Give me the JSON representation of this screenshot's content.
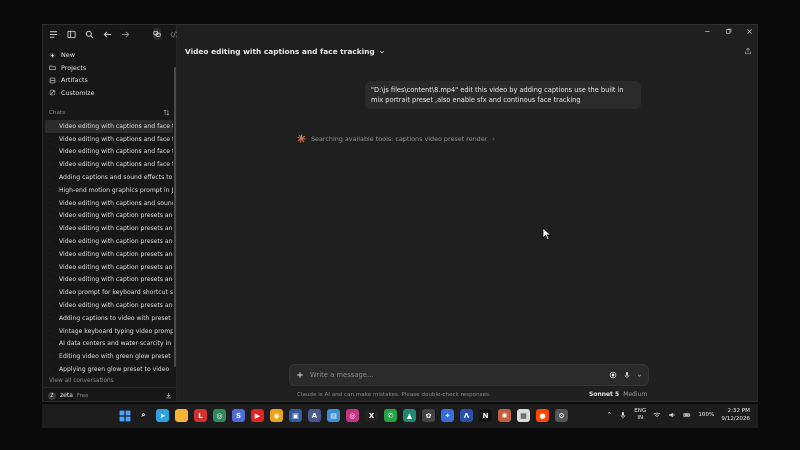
{
  "sidebar": {
    "nav": [
      {
        "label": "New",
        "icon": "plus-circle-icon"
      },
      {
        "label": "Projects",
        "icon": "folder-icon"
      },
      {
        "label": "Artifacts",
        "icon": "artifacts-icon"
      },
      {
        "label": "Customize",
        "icon": "customize-icon"
      }
    ],
    "chats_header": "Chats",
    "chats": [
      "Video editing with captions and face tr",
      "Video editing with captions and face tr",
      "Video editing with captions and face tr",
      "Video editing with captions and face tr",
      "Adding captions and sound effects to v",
      "High-end motion graphics prompt in JS",
      "Video editing with captions and sound",
      "Video editing with caption presets and",
      "Video editing with caption presets and",
      "Video editing with caption presets and",
      "Video editing with caption presets and",
      "Video editing with caption presets and",
      "Video editing with caption presets and",
      "Video prompt for keyboard shortcut sh",
      "Video editing with caption presets and",
      "Adding captions to video with preset",
      "Vintage keyboard typing video prompt",
      "AI data centers and water scarcity in In",
      "Editing video with green glow preset",
      "Applying green glow preset to video"
    ],
    "view_all": "View all conversations",
    "user": {
      "initial": "Z",
      "name": "zeta",
      "plan": "Free"
    }
  },
  "main": {
    "title": "Video editing with captions and face tracking",
    "user_message": "\"D:\\js files\\content\\8.mp4\" edit this video by adding captions use the built in mix portrait preset ,also enable sfx and continous face tracking",
    "status": "Searching available tools: captions video preset render",
    "composer_placeholder": "Write a message...",
    "model_name": "Sonnet 5",
    "model_mode": "Medium",
    "disclaimer": "Claude is AI and can make mistakes. Please double-check responses."
  },
  "taskbar": {
    "apps": [
      {
        "name": "windows-start-icon",
        "color": "#3b82f6",
        "glyph": ""
      },
      {
        "name": "search-icon",
        "color": "#1c1c1c",
        "glyph": "⌕"
      },
      {
        "name": "telegram-icon",
        "color": "#2aa3df",
        "glyph": "➤"
      },
      {
        "name": "file-explorer-icon",
        "color": "#f2b632",
        "glyph": ""
      },
      {
        "name": "app-l-icon",
        "color": "#d0312d",
        "glyph": "L"
      },
      {
        "name": "app-circle-icon",
        "color": "#2d8a5f",
        "glyph": "◎"
      },
      {
        "name": "app-s-icon",
        "color": "#4f6bd8",
        "glyph": "S"
      },
      {
        "name": "youtube-icon",
        "color": "#e02424",
        "glyph": "▶"
      },
      {
        "name": "chrome-icon",
        "color": "#e8a317",
        "glyph": "◉"
      },
      {
        "name": "app-photo-icon",
        "color": "#355c9c",
        "glyph": "▣"
      },
      {
        "name": "app-a-icon",
        "color": "#4a5a8c",
        "glyph": "A"
      },
      {
        "name": "app-book-icon",
        "color": "#3d8fd6",
        "glyph": "▤"
      },
      {
        "name": "instagram-icon",
        "color": "#c13584",
        "glyph": "◎"
      },
      {
        "name": "x-icon",
        "color": "#222222",
        "glyph": "X"
      },
      {
        "name": "whatsapp-icon",
        "color": "#25a244",
        "glyph": "✆"
      },
      {
        "name": "app-green-icon",
        "color": "#1f8a70",
        "glyph": "▲"
      },
      {
        "name": "chatgpt-icon",
        "color": "#444444",
        "glyph": "✿"
      },
      {
        "name": "gemini-icon",
        "color": "#3a6fd8",
        "glyph": "✦"
      },
      {
        "name": "app-blue-icon",
        "color": "#2b4fa8",
        "glyph": "Λ"
      },
      {
        "name": "notion-icon",
        "color": "#111111",
        "glyph": "N"
      },
      {
        "name": "claude-icon",
        "color": "#c2613c",
        "glyph": "✺"
      },
      {
        "name": "calendar-icon",
        "color": "#dcdcdc",
        "glyph": "▦"
      },
      {
        "name": "reddit-icon",
        "color": "#ff4500",
        "glyph": "●"
      },
      {
        "name": "settings-icon",
        "color": "#555555",
        "glyph": "⚙"
      }
    ],
    "lang_top": "ENG",
    "lang_bottom": "IN",
    "battery": "100%",
    "time": "2:32 PM",
    "date": "9/12/2026"
  }
}
